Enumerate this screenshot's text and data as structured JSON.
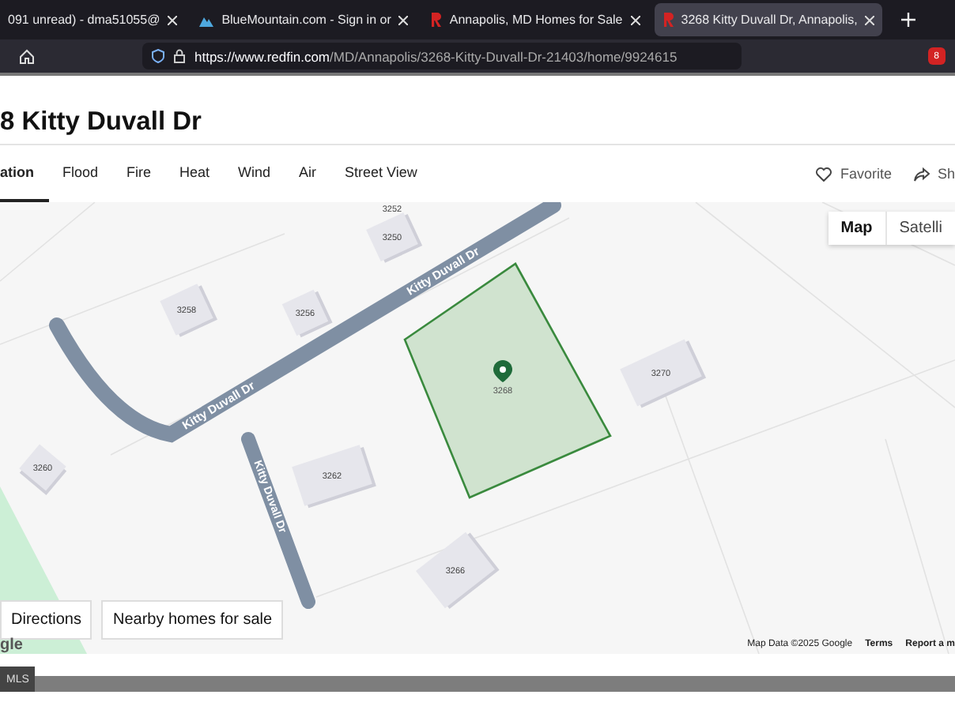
{
  "browser": {
    "tabs": [
      {
        "title": "091 unread) - dma51055@",
        "kind": "mail",
        "selected": false
      },
      {
        "title": "BlueMountain.com - Sign in or",
        "kind": "mountain",
        "selected": false
      },
      {
        "title": "Annapolis, MD Homes for Sale",
        "kind": "r",
        "selected": false
      },
      {
        "title": "3268 Kitty Duvall Dr, Annapolis,",
        "kind": "r",
        "selected": true
      }
    ],
    "url_domain": "https://www.redfin.com",
    "url_path": "/MD/Annapolis/3268-Kitty-Duvall-Dr-21403/home/9924615",
    "badge": "8"
  },
  "page": {
    "title": "8 Kitty Duvall Dr",
    "nav_tabs": [
      {
        "label": "ation",
        "selected": true
      },
      {
        "label": "Flood",
        "selected": false
      },
      {
        "label": "Fire",
        "selected": false
      },
      {
        "label": "Heat",
        "selected": false
      },
      {
        "label": "Wind",
        "selected": false
      },
      {
        "label": "Air",
        "selected": false
      },
      {
        "label": "Street View",
        "selected": false
      }
    ],
    "favorite": "Favorite",
    "share": "Sh"
  },
  "map": {
    "types": [
      {
        "label": "Map",
        "selected": true
      },
      {
        "label": "Satelli",
        "selected": false
      }
    ],
    "streets": [
      "Kitty Duvall Dr",
      "Kitty Duvall Dr",
      "Kitty Duvall Dr"
    ],
    "houses": [
      "3252",
      "3250",
      "3258",
      "3256",
      "3270",
      "3260",
      "3262",
      "3266"
    ],
    "parcel_number": "3268",
    "buttons": [
      "Directions",
      "Nearby homes for sale"
    ],
    "logo": "gle",
    "attribution": "Map Data ©2025 Google",
    "terms": "Terms",
    "report": "Report a m"
  },
  "footer": {
    "label": "MLS"
  }
}
